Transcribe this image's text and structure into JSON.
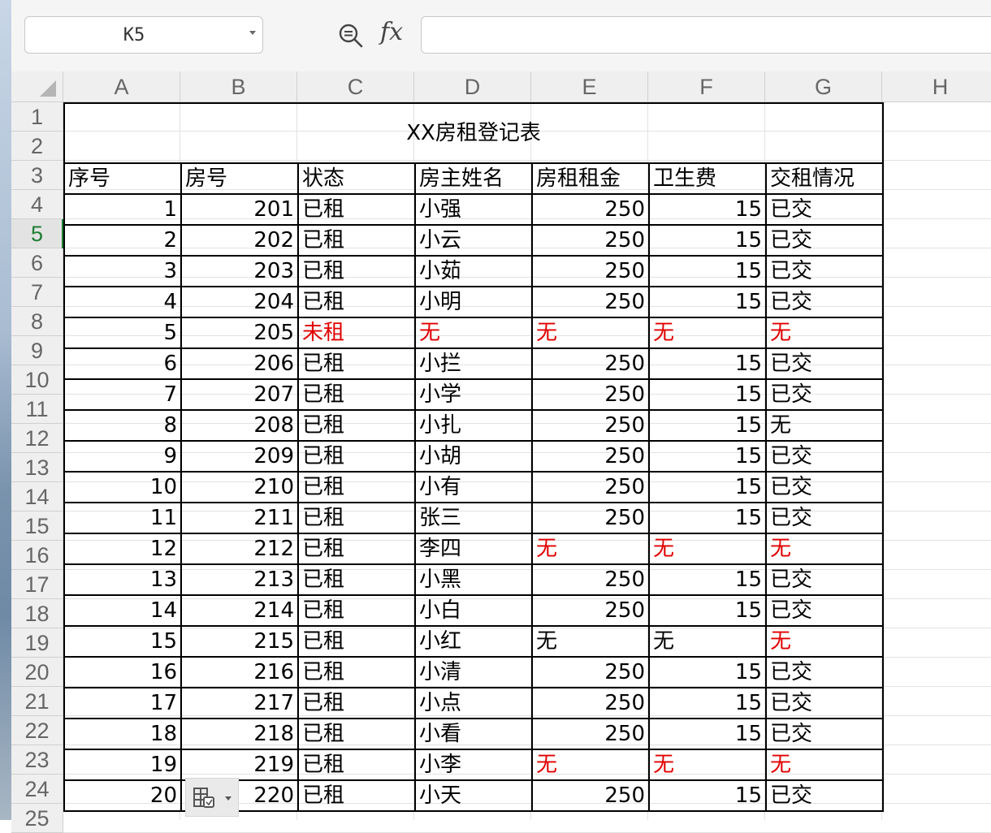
{
  "formula_bar": {
    "name_box": "K5",
    "zoom_icon": "zoom-formula-icon",
    "fx_label": "fx",
    "formula": ""
  },
  "columns": [
    "A",
    "B",
    "C",
    "D",
    "E",
    "F",
    "G",
    "H"
  ],
  "row_numbers": [
    "1",
    "2",
    "3",
    "4",
    "5",
    "6",
    "7",
    "8",
    "9",
    "10",
    "11",
    "12",
    "13",
    "14",
    "15",
    "16",
    "17",
    "18",
    "19",
    "20",
    "21",
    "22",
    "23",
    "24",
    "25"
  ],
  "active_row": "5",
  "sheet": {
    "title": "XX房租登记表",
    "headers": [
      "序号",
      "房号",
      "状态",
      "房主姓名",
      "房租租金",
      "卫生费",
      "交租情况"
    ],
    "rows": [
      {
        "a": "1",
        "b": "201",
        "c": "已租",
        "d": "小强",
        "e": "250",
        "f": "15",
        "g": "已交"
      },
      {
        "a": "2",
        "b": "202",
        "c": "已租",
        "d": "小云",
        "e": "250",
        "f": "15",
        "g": "已交"
      },
      {
        "a": "3",
        "b": "203",
        "c": "已租",
        "d": "小茹",
        "e": "250",
        "f": "15",
        "g": "已交"
      },
      {
        "a": "4",
        "b": "204",
        "c": "已租",
        "d": "小明",
        "e": "250",
        "f": "15",
        "g": "已交"
      },
      {
        "a": "5",
        "b": "205",
        "c": "未租",
        "d": "无",
        "e": "无",
        "f": "无",
        "g": "无"
      },
      {
        "a": "6",
        "b": "206",
        "c": "已租",
        "d": "小拦",
        "e": "250",
        "f": "15",
        "g": "已交"
      },
      {
        "a": "7",
        "b": "207",
        "c": "已租",
        "d": "小学",
        "e": "250",
        "f": "15",
        "g": "已交"
      },
      {
        "a": "8",
        "b": "208",
        "c": "已租",
        "d": "小扎",
        "e": "250",
        "f": "15",
        "g": "无"
      },
      {
        "a": "9",
        "b": "209",
        "c": "已租",
        "d": "小胡",
        "e": "250",
        "f": "15",
        "g": "已交"
      },
      {
        "a": "10",
        "b": "210",
        "c": "已租",
        "d": "小有",
        "e": "250",
        "f": "15",
        "g": "已交"
      },
      {
        "a": "11",
        "b": "211",
        "c": "已租",
        "d": "张三",
        "e": "250",
        "f": "15",
        "g": "已交"
      },
      {
        "a": "12",
        "b": "212",
        "c": "已租",
        "d": "李四",
        "e": "无",
        "f": "无",
        "g": "无"
      },
      {
        "a": "13",
        "b": "213",
        "c": "已租",
        "d": "小黑",
        "e": "250",
        "f": "15",
        "g": "已交"
      },
      {
        "a": "14",
        "b": "214",
        "c": "已租",
        "d": "小白",
        "e": "250",
        "f": "15",
        "g": "已交"
      },
      {
        "a": "15",
        "b": "215",
        "c": "已租",
        "d": "小红",
        "e": "无",
        "f": "无",
        "g": "无"
      },
      {
        "a": "16",
        "b": "216",
        "c": "已租",
        "d": "小清",
        "e": "250",
        "f": "15",
        "g": "已交"
      },
      {
        "a": "17",
        "b": "217",
        "c": "已租",
        "d": "小点",
        "e": "250",
        "f": "15",
        "g": "已交"
      },
      {
        "a": "18",
        "b": "218",
        "c": "已租",
        "d": "小看",
        "e": "250",
        "f": "15",
        "g": "已交"
      },
      {
        "a": "19",
        "b": "219",
        "c": "已租",
        "d": "小李",
        "e": "无",
        "f": "无",
        "g": "无"
      },
      {
        "a": "20",
        "b": "220",
        "c": "已租",
        "d": "小天",
        "e": "250",
        "f": "15",
        "g": "已交"
      }
    ],
    "red_cells": {
      "5": [
        "c",
        "d",
        "e",
        "f",
        "g"
      ],
      "12": [
        "e",
        "f",
        "g"
      ],
      "15": [
        "g"
      ],
      "19": [
        "e",
        "f",
        "g"
      ]
    }
  },
  "paste_options_icon": "paste-options-icon",
  "colors": {
    "red_text": "#e10000",
    "active_row_header": "#1e7e34",
    "header_bg": "#efefef"
  }
}
